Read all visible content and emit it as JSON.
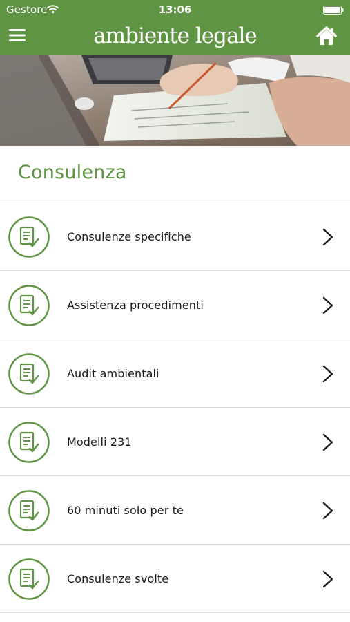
{
  "status_bar": {
    "carrier": "Gestore",
    "time": "13:06",
    "wifi_icon": "wifi-icon",
    "battery_icon": "battery-icon"
  },
  "header": {
    "brand": "ambiente legale",
    "menu_icon": "hamburger-menu-icon",
    "home_icon": "home-icon",
    "accent_color": "#5f9443"
  },
  "hero": {
    "image": "photo of hands writing on documents next to a laptop"
  },
  "section": {
    "title": "Consulenza"
  },
  "items": [
    {
      "label": "Consulenze specifiche",
      "icon": "document-check-icon",
      "action_icon": "chevron-right-icon"
    },
    {
      "label": "Assistenza procedimenti",
      "icon": "document-check-icon",
      "action_icon": "chevron-right-icon"
    },
    {
      "label": "Audit ambientali",
      "icon": "document-check-icon",
      "action_icon": "chevron-right-icon"
    },
    {
      "label": "Modelli 231",
      "icon": "document-check-icon",
      "action_icon": "chevron-right-icon"
    },
    {
      "label": "60 minuti solo per te",
      "icon": "document-check-icon",
      "action_icon": "chevron-right-icon"
    },
    {
      "label": "Consulenze svolte",
      "icon": "document-check-icon",
      "action_icon": "chevron-right-icon"
    }
  ]
}
